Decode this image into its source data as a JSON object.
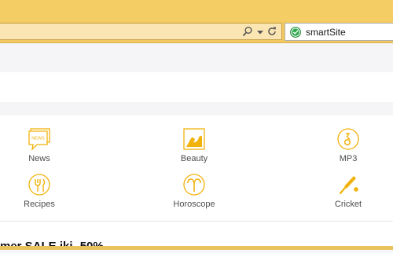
{
  "browser": {
    "tab_title": "smartSite",
    "accent": "#f4cd64"
  },
  "categories": [
    {
      "label": "News",
      "icon": "news-icon"
    },
    {
      "label": "Beauty",
      "icon": "beauty-icon"
    },
    {
      "label": "MP3",
      "icon": "mp3-icon"
    },
    {
      "label": "Recipes",
      "icon": "recipes-icon"
    },
    {
      "label": "Horoscope",
      "icon": "horoscope-icon"
    },
    {
      "label": "Cricket",
      "icon": "cricket-icon"
    }
  ],
  "icon_color": "#f1b20c",
  "news_icon_text": "NEWS",
  "promo_text": "mer SALE iki -50%"
}
